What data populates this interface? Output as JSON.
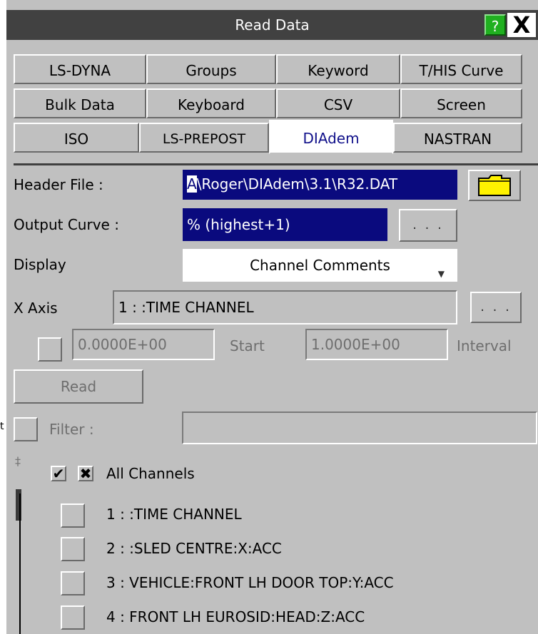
{
  "window": {
    "title": "Read Data",
    "help_label": "?",
    "close_label": "X"
  },
  "left_fragment": "t",
  "tabs": [
    {
      "label": "LS-DYNA"
    },
    {
      "label": "Groups"
    },
    {
      "label": "Keyword"
    },
    {
      "label": "T/HIS Curve"
    },
    {
      "label": "Bulk Data"
    },
    {
      "label": "Keyboard"
    },
    {
      "label": "CSV"
    },
    {
      "label": "Screen"
    },
    {
      "label": "ISO"
    },
    {
      "label": "LS-PREPOST"
    },
    {
      "label": "DIAdem",
      "active": true
    },
    {
      "label": "NASTRAN"
    }
  ],
  "header_file": {
    "label": "Header File :",
    "value_first": "A",
    "value_rest": "\\Roger\\DIAdem\\3.1\\R32.DAT",
    "icon": "folder-icon"
  },
  "output_curve": {
    "label": "Output Curve :",
    "value": "% (highest+1)",
    "button": ". . ."
  },
  "display": {
    "label": "Display",
    "value": "Channel Comments",
    "icon": "dropdown-arrow-icon"
  },
  "x_axis": {
    "label": "X Axis",
    "value": "1 : :TIME CHANNEL",
    "button": ". . ."
  },
  "start_interval": {
    "start_value": "0.0000E+00",
    "start_label": "Start",
    "interval_value": "1.0000E+00",
    "interval_label": "Interval"
  },
  "read_button": "Read",
  "filter": {
    "label": "Filter :",
    "value": ""
  },
  "channels": {
    "all_label": "All Channels",
    "items": [
      {
        "label": "1 : :TIME CHANNEL"
      },
      {
        "label": "2 : :SLED CENTRE:X:ACC"
      },
      {
        "label": "3 : VEHICLE:FRONT LH DOOR TOP:Y:ACC"
      },
      {
        "label": "4 : FRONT LH EUROSID:HEAD:Z:ACC"
      }
    ]
  },
  "colors": {
    "panel": "#c0c0c0",
    "titlebar": "#414141",
    "field_blue": "#0a0a7e",
    "help_green": "#20b020"
  }
}
